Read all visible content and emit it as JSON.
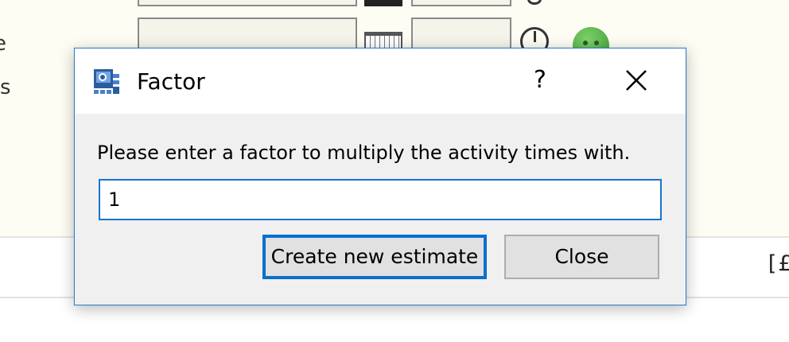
{
  "background": {
    "side_labels": [
      "e",
      "s"
    ],
    "currency_text": "[£"
  },
  "dialog": {
    "title": "Factor",
    "app_icon": "estimation-app-icon",
    "help_label": "?",
    "close_icon": "close-icon",
    "prompt": "Please enter a factor to multiply the activity times with.",
    "factor_value": "1",
    "primary_button_label": "Create new estimate",
    "close_button_label": "Close"
  },
  "colors": {
    "accent": "#1a73d0",
    "dialog_body": "#f0f0f0",
    "button_face": "#e1e1e1",
    "background_panel": "#fdfdf4"
  }
}
